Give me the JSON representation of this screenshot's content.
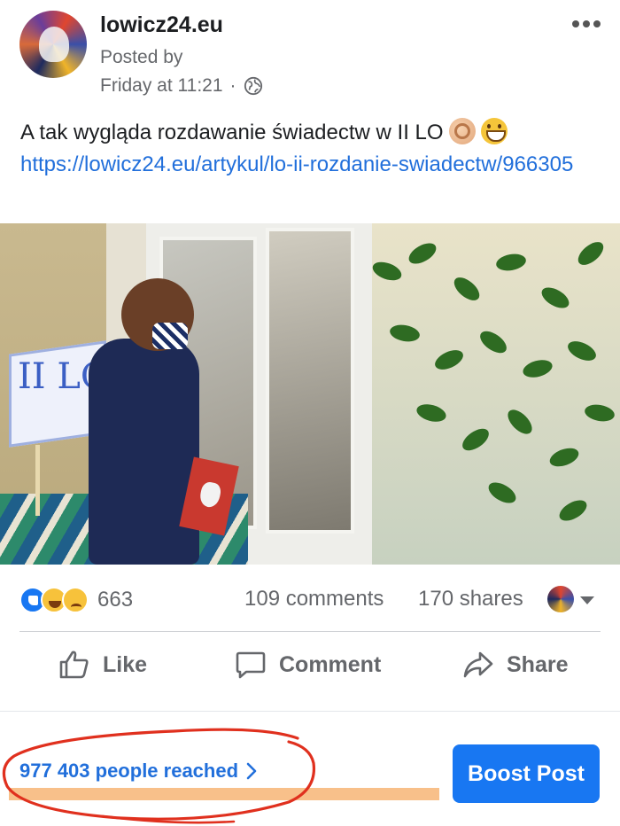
{
  "post": {
    "page_name": "lowicz24.eu",
    "posted_by": "Posted by",
    "timestamp": "Friday at 11:21",
    "separator": "·",
    "privacy_icon": "globe-icon",
    "more_icon": "more-horizontal-icon",
    "text": "A tak wygląda rozdawanie świadectw w II LO",
    "emojis": [
      "ok-hand-emoji",
      "grinning-face-emoji"
    ],
    "link": "https://lowicz24.eu/artykul/lo-ii-rozdanie-swiadectw/966305",
    "image": {
      "cube_text": "II LO"
    }
  },
  "stats": {
    "reaction_icons": [
      "like-reaction",
      "haha-reaction",
      "sad-reaction"
    ],
    "reaction_count": "663",
    "comments": "109 comments",
    "shares": "170 shares"
  },
  "actions": {
    "like": "Like",
    "comment": "Comment",
    "share": "Share"
  },
  "footer": {
    "reach": "977 403 people reached",
    "boost": "Boost Post"
  },
  "colors": {
    "link": "#216fdb",
    "boost_bg": "#1877f2",
    "annotation": "#e0301e",
    "highlight": "#f8c08a"
  }
}
